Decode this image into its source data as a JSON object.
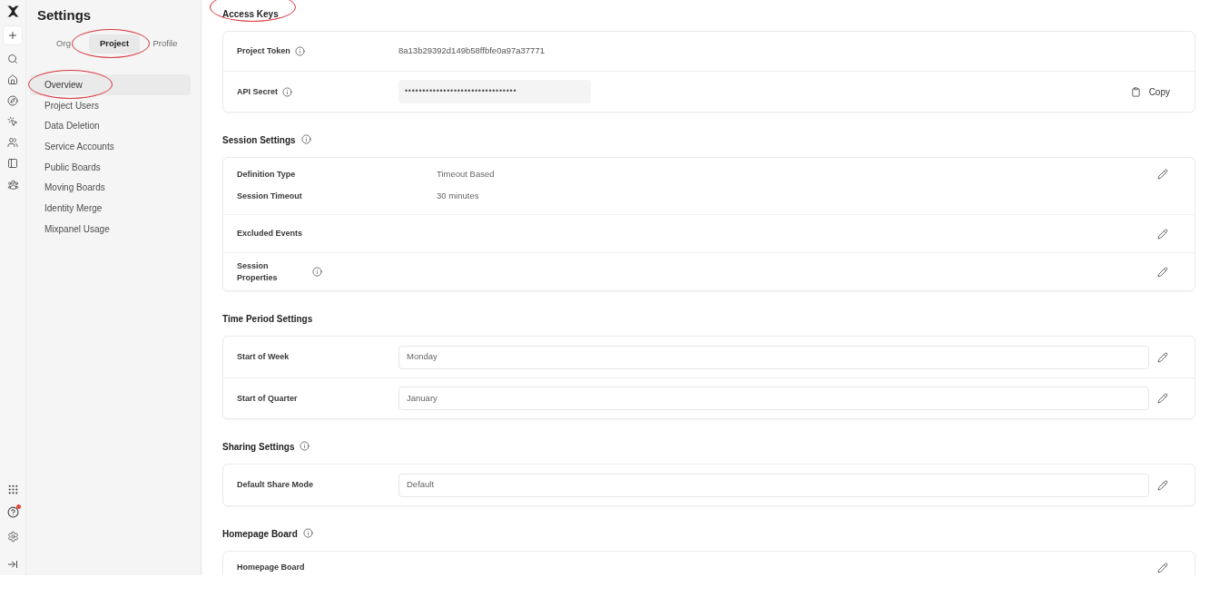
{
  "rail": {
    "help_notification": true
  },
  "sidebar": {
    "title": "Settings",
    "tabs": [
      {
        "label": "Org",
        "selected": false,
        "circled": false
      },
      {
        "label": "Project",
        "selected": true,
        "circled": true
      },
      {
        "label": "Profile",
        "selected": false,
        "circled": false
      }
    ],
    "items": [
      {
        "label": "Overview",
        "selected": true,
        "circled": true
      },
      {
        "label": "Project Users",
        "selected": false,
        "circled": false
      },
      {
        "label": "Data Deletion",
        "selected": false,
        "circled": false
      },
      {
        "label": "Service Accounts",
        "selected": false,
        "circled": false
      },
      {
        "label": "Public Boards",
        "selected": false,
        "circled": false
      },
      {
        "label": "Moving Boards",
        "selected": false,
        "circled": false
      },
      {
        "label": "Identity Merge",
        "selected": false,
        "circled": false
      },
      {
        "label": "Mixpanel Usage",
        "selected": false,
        "circled": false
      }
    ]
  },
  "sections": [
    {
      "title": "Access Keys",
      "info": false,
      "circled": true,
      "rows": [
        {
          "kind": "text",
          "label": "Project Token",
          "info": true,
          "value": "8a13b29392d149b58ffbfe0a97a37771"
        },
        {
          "kind": "secret",
          "label": "API Secret",
          "info": true,
          "value": "••••••••••••••••••••••••••••••••",
          "action": "Copy"
        }
      ]
    },
    {
      "title": "Session Settings",
      "info": true,
      "circled": false,
      "rows": [
        {
          "kind": "pairs",
          "pairs": [
            {
              "label": "Definition Type",
              "value": "Timeout Based"
            },
            {
              "label": "Session Timeout",
              "value": "30 minutes"
            }
          ],
          "editable": true
        },
        {
          "kind": "plain",
          "label": "Excluded Events",
          "info": false,
          "editable": true
        },
        {
          "kind": "plain",
          "label": "Session Properties",
          "info": true,
          "editable": true
        }
      ]
    },
    {
      "title": "Time Period Settings",
      "info": false,
      "circled": false,
      "rows": [
        {
          "kind": "field",
          "label": "Start of Week",
          "info": false,
          "value": "Monday",
          "editable": true
        },
        {
          "kind": "field",
          "label": "Start of Quarter",
          "info": false,
          "value": "January",
          "editable": true
        }
      ]
    },
    {
      "title": "Sharing Settings",
      "info": true,
      "circled": false,
      "rows": [
        {
          "kind": "field",
          "label": "Default Share Mode",
          "info": false,
          "value": "Default",
          "editable": true
        }
      ]
    },
    {
      "title": "Homepage Board",
      "info": true,
      "circled": false,
      "rows": [
        {
          "kind": "plain",
          "label": "Homepage Board",
          "info": false,
          "editable": true
        }
      ]
    }
  ]
}
